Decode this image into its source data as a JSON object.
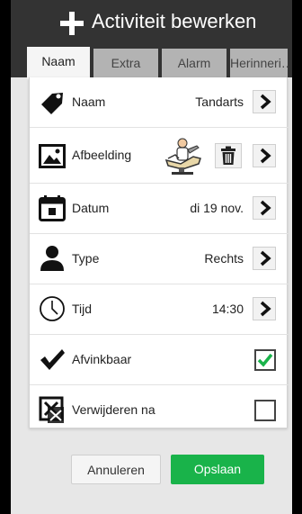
{
  "header": {
    "title": "Activiteit bewerken",
    "icon": "plus-icon"
  },
  "tabs": [
    {
      "label": "Naam",
      "active": true
    },
    {
      "label": "Extra",
      "active": false
    },
    {
      "label": "Alarm",
      "active": false
    },
    {
      "label": "Herinneri…",
      "active": false
    }
  ],
  "rows": {
    "naam": {
      "label": "Naam",
      "value": "Tandarts",
      "icon": "tag-icon"
    },
    "afbeelding": {
      "label": "Afbeelding",
      "icon": "image-icon"
    },
    "datum": {
      "label": "Datum",
      "value": "di 19 nov.",
      "icon": "calendar-icon"
    },
    "type": {
      "label": "Type",
      "value": "Rechts",
      "icon": "person-icon"
    },
    "tijd": {
      "label": "Tijd",
      "value": "14:30",
      "icon": "clock-icon"
    },
    "afvinkbaar": {
      "label": "Afvinkbaar",
      "checked": true,
      "icon": "checkmark-icon"
    },
    "verwijderen": {
      "label": "Verwijderen na",
      "checked": false,
      "icon": "delete-box-icon"
    }
  },
  "footer": {
    "cancel_label": "Annuleren",
    "save_label": "Opslaan"
  },
  "colors": {
    "header": "#333333",
    "save": "#19b34a",
    "check": "#19b34a"
  }
}
